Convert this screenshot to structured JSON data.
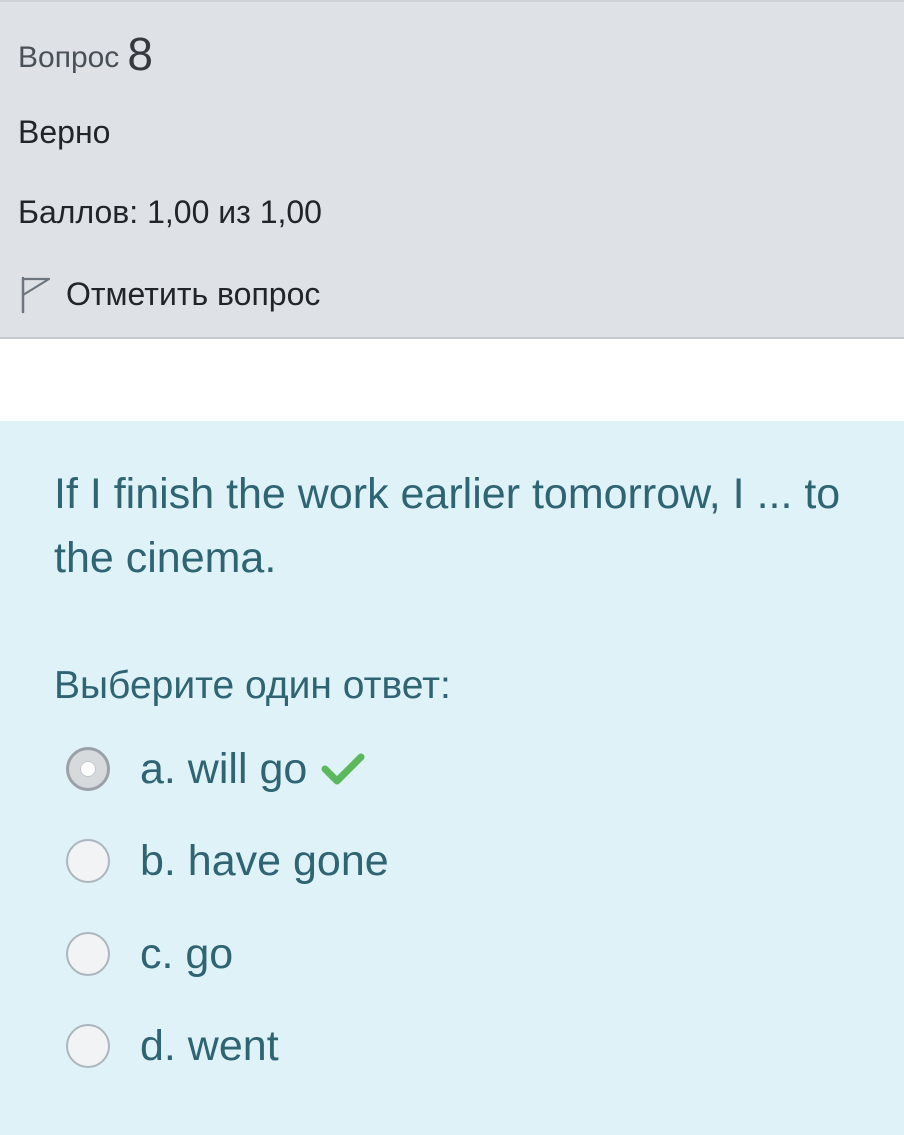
{
  "info": {
    "question_label": "Вопрос",
    "question_number": "8",
    "state": "Верно",
    "grade": "Баллов: 1,00 из 1,00",
    "flag_label": "Отметить вопрос"
  },
  "question": {
    "text": "If I finish the work earlier tomorrow, I ... to the cinema.",
    "prompt": "Выберите один ответ:"
  },
  "answers": [
    {
      "label": "a. will go",
      "selected": true,
      "correct": true
    },
    {
      "label": "b. have gone",
      "selected": false
    },
    {
      "label": "c. go",
      "selected": false
    },
    {
      "label": "d. went",
      "selected": false
    }
  ],
  "colors": {
    "info_background": "#dee2e6",
    "content_background": "#def2f8",
    "question_text": "#2f6473",
    "correct_check": "#5cb85c"
  },
  "icons": {
    "flag": "flag-icon",
    "correct": "check-icon"
  }
}
